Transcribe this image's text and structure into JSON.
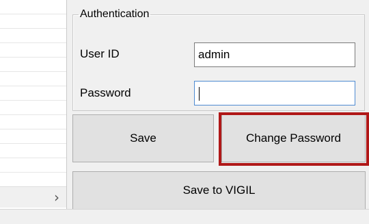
{
  "auth_group": {
    "legend": "Authentication",
    "user_id_label": "User ID",
    "user_id_value": "admin",
    "password_label": "Password",
    "password_value": ""
  },
  "buttons": {
    "save": "Save",
    "change_password": "Change Password",
    "save_to_vigil": "Save to VIGIL"
  },
  "scroll_arrow": "›",
  "colors": {
    "highlight": "#b01818",
    "button_face": "#e1e1e1",
    "window_bg": "#f0f0f0"
  }
}
